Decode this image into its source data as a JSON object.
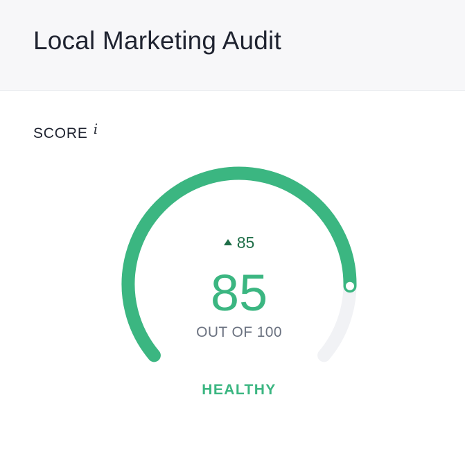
{
  "header": {
    "title": "Local Marketing Audit"
  },
  "score_card": {
    "label": "SCORE",
    "info_icon": "info-icon",
    "info_glyph": "i",
    "delta_icon": "triangle-up-icon",
    "delta_value": "85",
    "score_value": "85",
    "score": 85,
    "score_max": 100,
    "out_of_text": "OUT OF 100",
    "status": "HEALTHY"
  },
  "colors": {
    "accent_green": "#3bb681",
    "delta_green": "#1f6e48",
    "track_gray": "#f1f2f5",
    "header_bg": "#f7f7f9"
  }
}
